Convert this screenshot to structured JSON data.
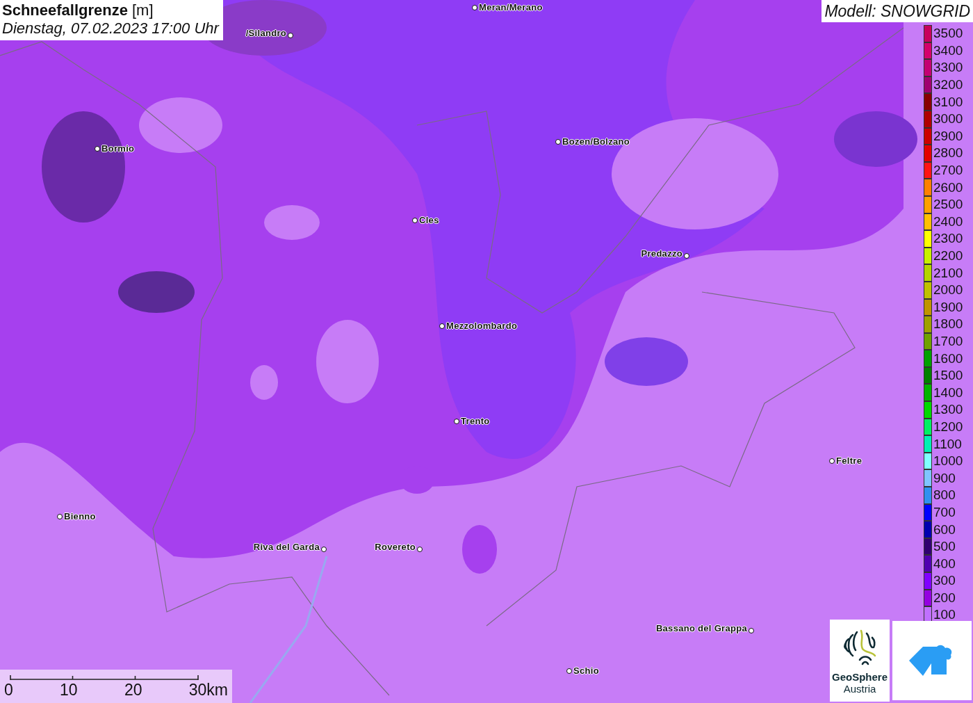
{
  "title": {
    "name": "Schneefallgrenze",
    "unit": "[m]",
    "datetime": "Dienstag, 07.02.2023 17:00 Uhr"
  },
  "model": "Modell: SNOWGRID",
  "cities": [
    {
      "name": "Meran/Merano"
    },
    {
      "name": "/Silandro"
    },
    {
      "name": "Bormio"
    },
    {
      "name": "Bozen/Bolzano"
    },
    {
      "name": "Cles"
    },
    {
      "name": "Predazzo"
    },
    {
      "name": "Mezzolombardo"
    },
    {
      "name": "Trento"
    },
    {
      "name": "Feltre"
    },
    {
      "name": "Bienno"
    },
    {
      "name": "Riva del Garda"
    },
    {
      "name": "Rovereto"
    },
    {
      "name": "Bassano del Grappa"
    },
    {
      "name": "Schio"
    }
  ],
  "legend": [
    {
      "label": "3500",
      "color": "#c8005c"
    },
    {
      "label": "3400",
      "color": "#d4006c"
    },
    {
      "label": "3300",
      "color": "#c40072"
    },
    {
      "label": "3200",
      "color": "#a00070"
    },
    {
      "label": "3100",
      "color": "#880000"
    },
    {
      "label": "3000",
      "color": "#b00000"
    },
    {
      "label": "2900",
      "color": "#cc0000"
    },
    {
      "label": "2800",
      "color": "#e40000"
    },
    {
      "label": "2700",
      "color": "#ff1414"
    },
    {
      "label": "2600",
      "color": "#ff8000"
    },
    {
      "label": "2500",
      "color": "#ffa000"
    },
    {
      "label": "2400",
      "color": "#ffc000"
    },
    {
      "label": "2300",
      "color": "#ffff00"
    },
    {
      "label": "2200",
      "color": "#c8f000"
    },
    {
      "label": "2100",
      "color": "#b4d400"
    },
    {
      "label": "2000",
      "color": "#c0c000"
    },
    {
      "label": "1900",
      "color": "#c09400"
    },
    {
      "label": "1800",
      "color": "#a0a000"
    },
    {
      "label": "1700",
      "color": "#70a000"
    },
    {
      "label": "1600",
      "color": "#00a000"
    },
    {
      "label": "1500",
      "color": "#008000"
    },
    {
      "label": "1400",
      "color": "#00b400"
    },
    {
      "label": "1300",
      "color": "#00d800"
    },
    {
      "label": "1200",
      "color": "#00f064"
    },
    {
      "label": "1100",
      "color": "#00f0b4"
    },
    {
      "label": "1000",
      "color": "#80ffff"
    },
    {
      "label": "900",
      "color": "#80c4ff"
    },
    {
      "label": "800",
      "color": "#3090f0"
    },
    {
      "label": "700",
      "color": "#0000ff"
    },
    {
      "label": "600",
      "color": "#0000b0"
    },
    {
      "label": "500",
      "color": "#300070"
    },
    {
      "label": "400",
      "color": "#5000b0"
    },
    {
      "label": "300",
      "color": "#8000ff"
    },
    {
      "label": "200",
      "color": "#9400e0"
    },
    {
      "label": "100",
      "color": "#c070ff"
    }
  ],
  "scale": [
    "0",
    "10",
    "20",
    "30km"
  ],
  "logo": {
    "line1": "GeoSphere",
    "line2": "Austria"
  }
}
